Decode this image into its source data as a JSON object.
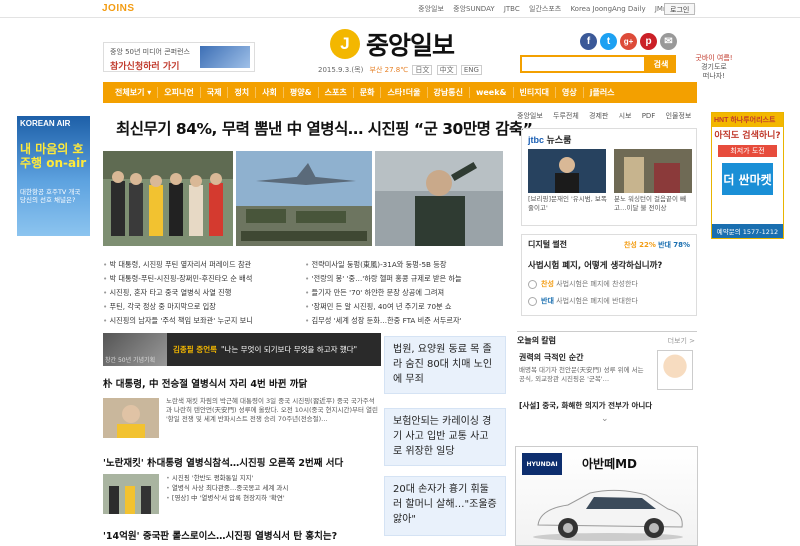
{
  "topbar": {
    "logo": "JOINS",
    "links": [
      "중앙일보",
      "중앙SUNDAY",
      "JTBC",
      "일간스포츠",
      "Korea JoongAng Daily",
      "JMnet 더보기"
    ],
    "login": "로그인"
  },
  "header": {
    "promo_line": "중앙 50년 미디어 콘퍼런스",
    "promo_cta": "참가신청하러 가기",
    "brand": "중앙일보",
    "brand_mark": "J",
    "date": "2015.9.3.(목)",
    "weather": "부산 27.8℃",
    "editions": [
      "日文",
      "中文",
      "ENG"
    ],
    "search_button": "검색",
    "side_ad_line1": "굿바이 여름!",
    "side_ad_line2": "경기도로",
    "side_ad_line3": "떠나자!"
  },
  "social": [
    "f",
    "t",
    "g+",
    "p",
    "✉"
  ],
  "nav": [
    "전체보기 ▾",
    "오피니언",
    "국제",
    "정치",
    "사회",
    "평양&",
    "스포츠",
    "문화",
    "스타!더울",
    "강남통신",
    "week&",
    "빈티지대",
    "영상",
    "j플러스"
  ],
  "headline": "최신무기 84%, 무력 뽐낸 中 열병식… 시진핑 “군 30만명 감축”",
  "bullets_left": [
    "박 대통령, 시진핑 푸틴 옆자리서 퍼레이드 참관",
    "박 대통령-푸틴-시진핑-장쩌민-후진타오 순 배석",
    "시진핑, 혼자 타고 중국 열병식 사열 진행",
    "푸틴, 각국 정상 중 마지막으로 입장",
    "시진핑의 남자들 '주석 책임 보좌관' 누군지 보니"
  ],
  "bullets_right": [
    "전략미사일 둥펑(東風)-31A와 둥펑-5B 등장",
    "'전랑의 봉' '중…'하랑 헬퍼 홍콩 규제로 받은 하늘",
    "들기자 만든 '70' 하얀한 문장 상공에 그려져",
    "'장쩌민 든 알 시진핑, 40여 년 주기로 70분 쇼",
    "김무성 '세계 성장 둔화…한중 FTA 비준 서두르자'"
  ],
  "promo_bar": {
    "thumb_label": "창간 50년 기념기획",
    "name": "김종필 증언록",
    "quote": "\"나는 무엇이 되기보다 무엇을 하고자 했다\""
  },
  "stories": [
    {
      "title": "朴 대통령, 中 전승절 열병식서 자리 4번 바뀐 까닭",
      "text": "노란색 재킷 차림의 박근혜 대통령이 3일 중국 시진핑(習近平) 중국 국가주석과 나란히 텐안먼(天安門) 성루에 올랐다. 오전 10시(중국 현지시간)부터 열린 '항일 전쟁 및 세계 반파시스트 전쟁 승리 70주년(전승절)…"
    },
    {
      "title": "'노란재킷' 朴대통령 열병식참석…시진핑 오른쪽 2번째 서다",
      "items": [
        "시진핑 '한반도 평화통일 지지'",
        "열병식 사상 최다관중…중국몽고 세계 과시",
        "[영상] 中 '열병식'서 압록 현장지하 '확연'"
      ]
    },
    {
      "title": "'14억원' 중국판 롤스로이스…시진핑 열병식서 탄 홍치는?"
    }
  ],
  "tiles": [
    "법원, 요양원 동료 목 졸라 숨진 80대 치매 노인에 무죄",
    "보험안되는 카레이싱 경기 사고 입반 교통 사고로 위장한 일당",
    "20대 손자가 흉기 휘둘러 할머니 살해…\"조울증 앓아\""
  ],
  "right_tabs": [
    "중앙일보",
    "두루전체",
    "경제판",
    "시보",
    "PDF",
    "인물정보"
  ],
  "jtbc": {
    "title_b": "jtbc",
    "title": "뉴스룸",
    "cap1": "[브리핑]문재인 '유시범, 보폭줄이고'",
    "cap2": "분노 워싱턴이 걸음끝이 빼고…이달 불 전이상"
  },
  "digital": {
    "title": "디지털 썰전",
    "yes_label": "찬성",
    "yes_pct": "22%",
    "no_label": "반대",
    "no_pct": "78%",
    "question": "사법시험 폐지, 어떻게 생각하십니까?",
    "opt_yes": "찬성",
    "opt_yes_text": "사법시험은 폐지에 찬성한다",
    "opt_no": "반대",
    "opt_no_text": "사법시험은 폐지에 반대한다"
  },
  "column": {
    "header": "오늘의 칼럼",
    "more": "더보기 >",
    "title": "권력의 극적인 순간",
    "sub": "배명복 대기자 천안문(天安門) 성루 위에 서는 공식, 외교장관 시진핑은 '군복'…",
    "sawon": "[사설] 중국, 화해한 의지가 전부가 아니다",
    "chevron": "⌄"
  },
  "car_ad": {
    "brand": "HYUNDAI",
    "model": "아반떼MD"
  },
  "left_ad": {
    "label": "KOREAN AIR",
    "big": "내 마음의 호주행 on-air",
    "small": "대한항공 호주TV 개국 당신의 선호 채널은?"
  },
  "right_ad": {
    "top": "HNT 하나투어리스트",
    "mid": "아직도 검색하니?",
    "chip": "최저가 도전",
    "logo": "더 싼마켓",
    "tel": "예약문의 1577-1212"
  }
}
